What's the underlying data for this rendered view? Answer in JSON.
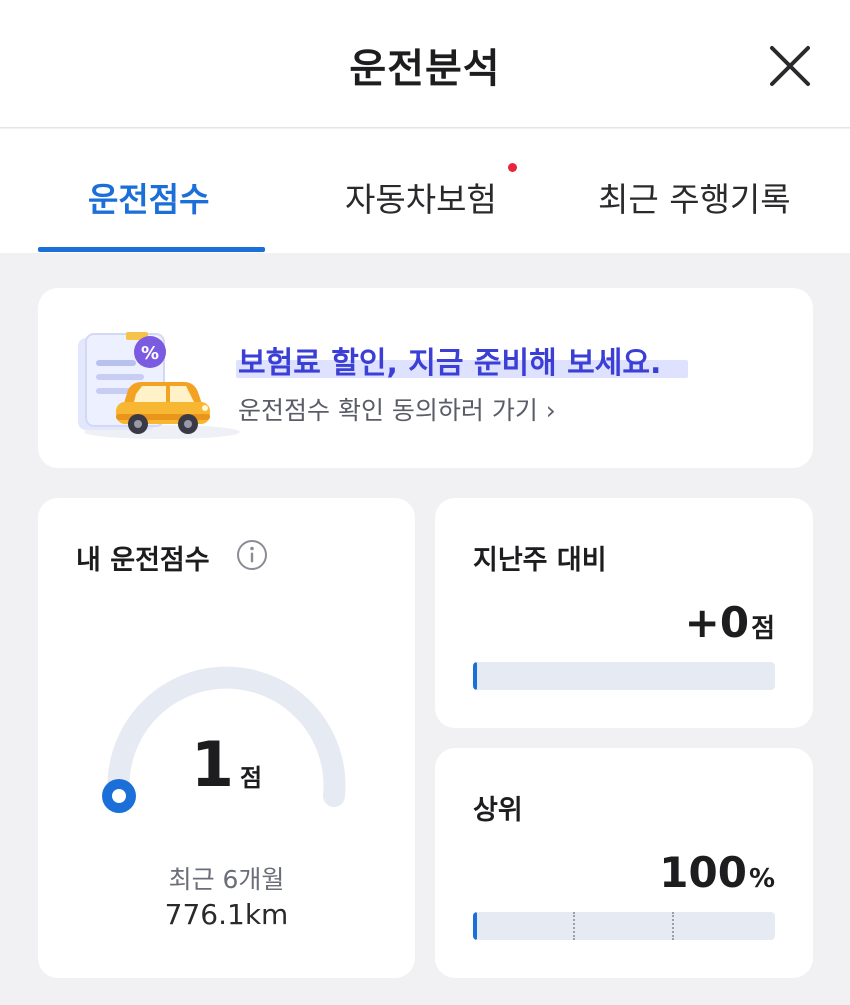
{
  "header": {
    "title": "운전분석",
    "close_icon": "close-icon"
  },
  "tabs": [
    {
      "label": "운전점수",
      "active": true
    },
    {
      "label": "자동차보험",
      "active": false,
      "has_new_dot": true
    },
    {
      "label": "최근 주행기록",
      "active": false
    }
  ],
  "promo": {
    "title": "보험료 할인, 지금 준비해 보세요.",
    "subtitle": "운전점수 확인 동의하러 가기 ›",
    "illustration": "document-car-discount-illustration"
  },
  "score": {
    "label": "내 운전점수",
    "info_icon": "info-icon",
    "value": "1",
    "unit": "점",
    "max": 100,
    "recent_label": "최근 6개월",
    "distance": "776.1km"
  },
  "weekly": {
    "label": "지난주 대비",
    "value": "+0",
    "unit": "점",
    "progress_fraction": 0.0
  },
  "rank": {
    "label": "상위",
    "value": "100",
    "unit": "%",
    "progress_fraction": 0.0
  },
  "colors": {
    "accent": "#1b6fd8",
    "promo_title": "#3b3fd6",
    "new_dot": "#e8253a",
    "background": "#f1f1f3",
    "track": "#e6eaf2"
  }
}
